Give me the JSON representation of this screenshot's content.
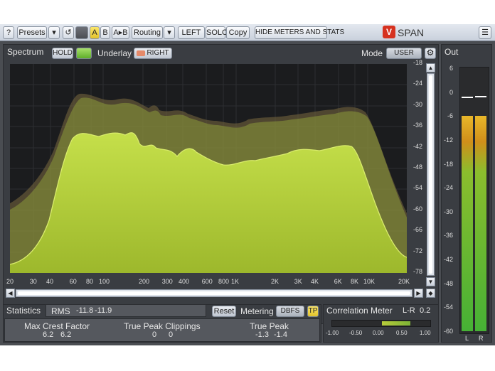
{
  "toolbar": {
    "help": "?",
    "presets": "Presets",
    "dropdown": "▾",
    "undo": "↺",
    "a": "A",
    "b": "B",
    "atob": "A▸B",
    "routing": "Routing",
    "routing_dd": "▾",
    "left": "LEFT",
    "solo": "SOLO",
    "copy": "Copy",
    "hide_meters": "HIDE METERS AND STATS",
    "app_name": "SPAN",
    "menu": "☰"
  },
  "spectrum": {
    "title": "Spectrum",
    "hold": "HOLD",
    "underlay_label": "Underlay",
    "underlay_btn": "RIGHT",
    "mode_label": "Mode",
    "mode_value": "USER",
    "db_ticks": [
      "-18",
      "-24",
      "-30",
      "-36",
      "-42",
      "-48",
      "-54",
      "-60",
      "-66",
      "-72",
      "-78"
    ],
    "freq_ticks": [
      "20",
      "30",
      "40",
      "60",
      "80",
      "100",
      "200",
      "300",
      "400",
      "600",
      "800",
      "1K",
      "2K",
      "3K",
      "4K",
      "6K",
      "8K",
      "10K",
      "20K"
    ]
  },
  "out": {
    "title": "Out",
    "ticks": [
      "6",
      "0",
      "-6",
      "-12",
      "-18",
      "-24",
      "-30",
      "-36",
      "-42",
      "-48",
      "-54",
      "-60"
    ],
    "left_label": "L",
    "right_label": "R",
    "level_l_db": -6,
    "level_r_db": -6
  },
  "statistics": {
    "title": "Statistics",
    "rms_label": "RMS",
    "rms_l": "-11.8",
    "rms_r": "-11.9",
    "reset": "Reset",
    "metering_label": "Metering",
    "metering_value": "DBFS",
    "tp": "TP",
    "crest_label": "Max Crest Factor",
    "crest_l": "6.2",
    "crest_r": "6.2",
    "clip_label": "True Peak Clippings",
    "clip_l": "0",
    "clip_r": "0",
    "tp_label": "True Peak",
    "tp_l": "-1.3",
    "tp_r": "-1.4"
  },
  "correlation": {
    "title": "Correlation Meter",
    "lr_label": "L-R",
    "lr_value": "0.2",
    "ticks": [
      "-1.00",
      "-0.50",
      "0.00",
      "0.50",
      "1.00"
    ]
  },
  "colors": {
    "accent_green": "#a9c23a",
    "accent_yellow": "#f1d84a",
    "meter_green": "#3fae2f",
    "meter_orange": "#e79a1e"
  }
}
